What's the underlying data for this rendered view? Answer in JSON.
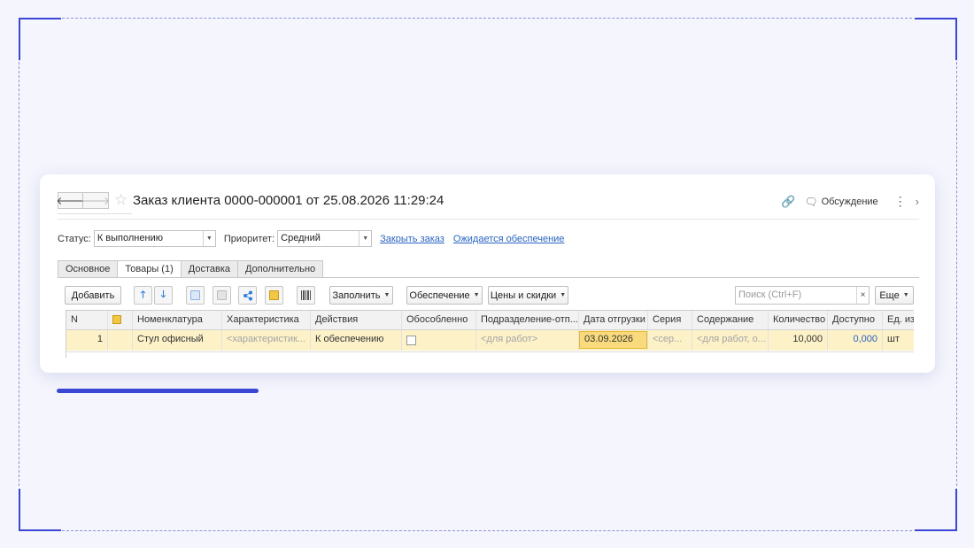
{
  "header": {
    "title": "Заказ клиента 0000-000001 от 25.08.2026 11:29:24",
    "back_glyph": "🡐",
    "forward_glyph": "🡒",
    "star_glyph": "☆",
    "discussion_label": "Обсуждение",
    "link_glyph": "🔗",
    "discussion_glyph": "🗨",
    "more_glyph": "⋮",
    "next_glyph": "›"
  },
  "status_bar": {
    "status_label": "Статус:",
    "status_value": "К выполнению",
    "priority_label": "Приоритет:",
    "priority_value": "Средний",
    "combo_arrow": "▼",
    "close_order_link": "Закрыть заказ",
    "awaiting_supply_link": "Ожидается обеспечение"
  },
  "tabs": [
    {
      "label": "Основное"
    },
    {
      "label": "Товары (1)"
    },
    {
      "label": "Доставка"
    },
    {
      "label": "Дополнительно"
    }
  ],
  "toolbar": {
    "add_label": "Добавить",
    "up_glyph": "🡑",
    "down_glyph": "🡓",
    "fill_label": "Заполнить",
    "supply_label": "Обеспечение",
    "prices_label": "Цены и скидки",
    "dropdown_glyph": "▼",
    "search_placeholder": "Поиск (Ctrl+F)",
    "search_clear": "×",
    "more_label": "Еще"
  },
  "table": {
    "columns": [
      "N",
      "",
      "Номенклатура",
      "Характеристика",
      "Действия",
      "Обособленно",
      "Подразделение-отп...",
      "Дата отгрузки",
      "Серия",
      "Содержание",
      "Количество",
      "Доступно",
      "Ед. изм."
    ],
    "rows": [
      {
        "n": "1",
        "nomenclature": "Стул офисный",
        "characteristic": "<характеристик...",
        "action": "К обеспечению",
        "division": "<для работ>",
        "ship_date": "03.09.2026",
        "series": "<сер...",
        "content": "<для работ, о...",
        "quantity": "10,000",
        "available": "0,000",
        "unit": "шт"
      }
    ]
  },
  "colors": {
    "accent": "#3a47d5",
    "selected_row": "#fdf1c8",
    "link": "#2a64c0",
    "date_highlight": "#f9db7d"
  }
}
